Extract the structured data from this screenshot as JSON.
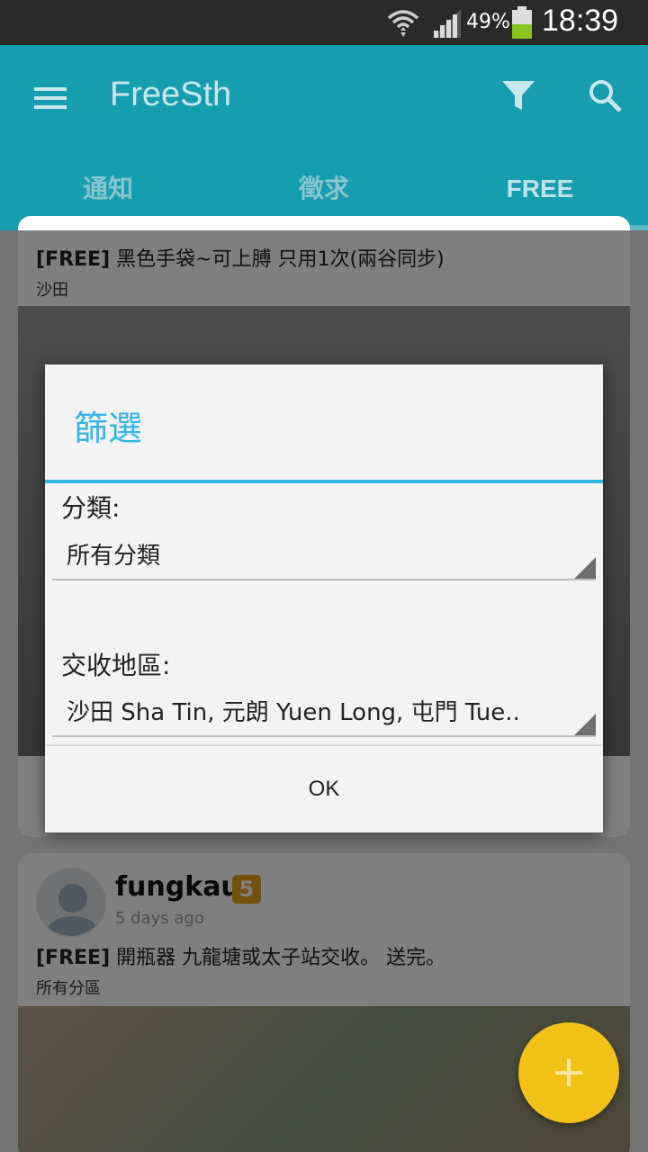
{
  "status_bar": {
    "battery_percent": "49%",
    "time": "18:39"
  },
  "app_bar": {
    "title": "FreeSth"
  },
  "tabs": [
    {
      "label": "通知",
      "selected": false
    },
    {
      "label": "徵求",
      "selected": false
    },
    {
      "label": "FREE",
      "selected": true
    }
  ],
  "feed": [
    {
      "tag": "[FREE]",
      "title": " 黑色手袋~可上膊 只用1次(兩谷同步)",
      "region": "沙田"
    },
    {
      "username": "fungkau",
      "level": "5",
      "time_ago": "5 days ago",
      "tag": "[FREE]",
      "title": " 開瓶器 九龍塘或太子站交收。 送完。",
      "region": "所有分區"
    }
  ],
  "dialog": {
    "title": "篩選",
    "category_label": "分類:",
    "category_value": "所有分類",
    "region_label": "交收地區:",
    "region_value": "沙田 Sha Tin, 元朗 Yuen Long, 屯門 Tue..",
    "ok_label": "OK"
  },
  "colors": {
    "primary": "#179db0",
    "accent": "#33b5e5",
    "fab": "#f2c117",
    "badge": "#e6a21a"
  },
  "icons": [
    "wifi-icon",
    "signal-icon",
    "battery-icon",
    "menu-icon",
    "filter-icon",
    "search-icon",
    "plus-icon"
  ]
}
